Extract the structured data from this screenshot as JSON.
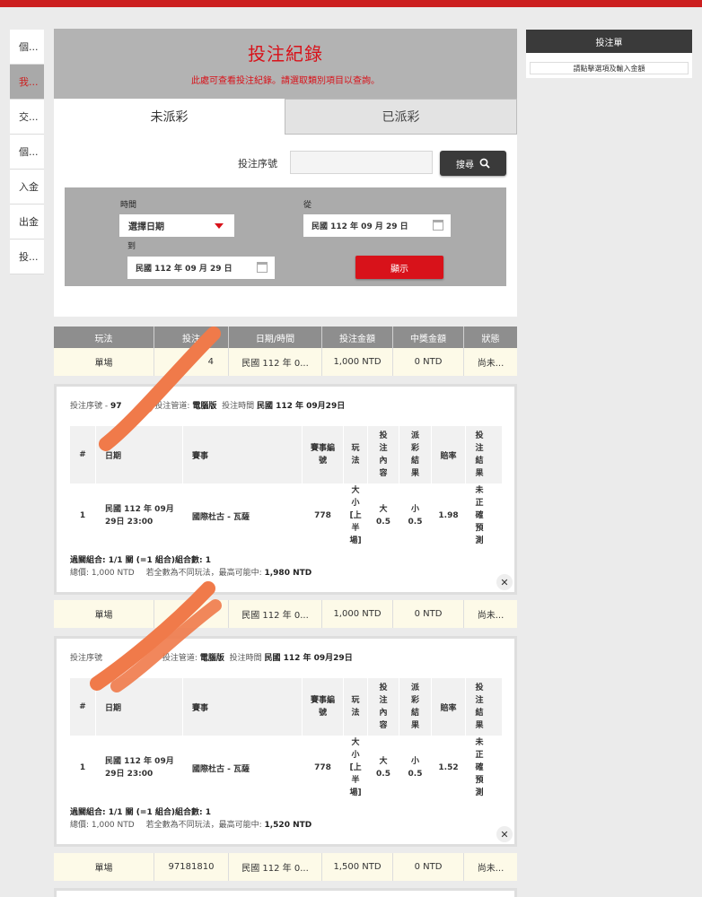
{
  "nav": [
    "個...",
    "我...",
    "交...",
    "個...",
    "入金",
    "出金",
    "投..."
  ],
  "header": {
    "title": "投注紀錄",
    "subtitle": "此處可查看投注紀錄。請選取類別項目以查詢。"
  },
  "tabs": [
    "未派彩",
    "已派彩"
  ],
  "search": {
    "label": "投注序號",
    "value": "",
    "button": "搜尋"
  },
  "filter": {
    "time_label": "時間",
    "from_label": "從",
    "to_label": "到",
    "select_value": "選擇日期",
    "from_date": "民國 112 年 09 月 29 日",
    "to_date": "民國 112 年 09 月 29 日",
    "show_button": "顯示"
  },
  "columns": [
    "玩法",
    "投注",
    "日期/時間",
    "投注金額",
    "中獎金額",
    "狀態"
  ],
  "bets": [
    {
      "play": "單場",
      "id": "4",
      "date": "民國 112 年 0...",
      "amount": "1,000 NTD",
      "win": "0 NTD",
      "status": "尚未..."
    },
    {
      "play": "單場",
      "id": "",
      "date": "民國 112 年 0...",
      "amount": "1,000 NTD",
      "win": "0 NTD",
      "status": "尚未..."
    },
    {
      "play": "單場",
      "id": "97181810",
      "date": "民國 112 年 0...",
      "amount": "1,500 NTD",
      "win": "0 NTD",
      "status": "尚未..."
    }
  ],
  "details": [
    {
      "meta_id_label": "投注序號",
      "meta_id": "97",
      "meta_channel_label": "投注管道:",
      "meta_channel": "電腦版",
      "meta_time_label": "投注時間",
      "meta_time": "民國 112 年 09月29日",
      "head": [
        "#",
        "日期",
        "賽事",
        "賽事編號",
        "玩法",
        "投注內容",
        "派彩結果",
        "賠率",
        "投注結果"
      ],
      "row": {
        "no": "1",
        "date": "民國 112 年 09月 29日 23:00",
        "event": "國際杜古 - 瓦薩",
        "event_no": "778",
        "play": "大小[上半場]",
        "bet": "大 0.5",
        "result": "小 0.5",
        "odds": "1.98",
        "outcome": "未正確預測"
      },
      "combo": "過關組合: 1/1 關 (=1 組合)組合數: 1",
      "total_label": "總價: 1,000 NTD",
      "note": "若全數為不同玩法，最高可能中:",
      "max_win": "1,980 NTD"
    },
    {
      "meta_id_label": "投注序號",
      "meta_id": "",
      "meta_channel_label": "投注管道:",
      "meta_channel": "電腦版",
      "meta_time_label": "投注時間",
      "meta_time": "民國 112 年 09月29日",
      "head": [
        "#",
        "日期",
        "賽事",
        "賽事編號",
        "玩法",
        "投注內容",
        "派彩結果",
        "賠率",
        "投注結果"
      ],
      "row": {
        "no": "1",
        "date": "民國 112 年 09月 29日 23:00",
        "event": "國際杜古 - 瓦薩",
        "event_no": "778",
        "play": "大小[上半場]",
        "bet": "大 0.5",
        "result": "小 0.5",
        "odds": "1.52",
        "outcome": "未正確預測"
      },
      "combo": "過關組合: 1/1 關 (=1 組合)組合數: 1",
      "total_label": "總價: 1,000 NTD",
      "note": "若全數為不同玩法，最高可能中:",
      "max_win": "1,520 NTD"
    }
  ],
  "betslip": {
    "title": "投注單",
    "message": "請點擊選項及輸入金額"
  },
  "colors": {
    "accent": "#d8121a",
    "topbar": "#cc1f1f",
    "scribble": "#f07a4a"
  }
}
